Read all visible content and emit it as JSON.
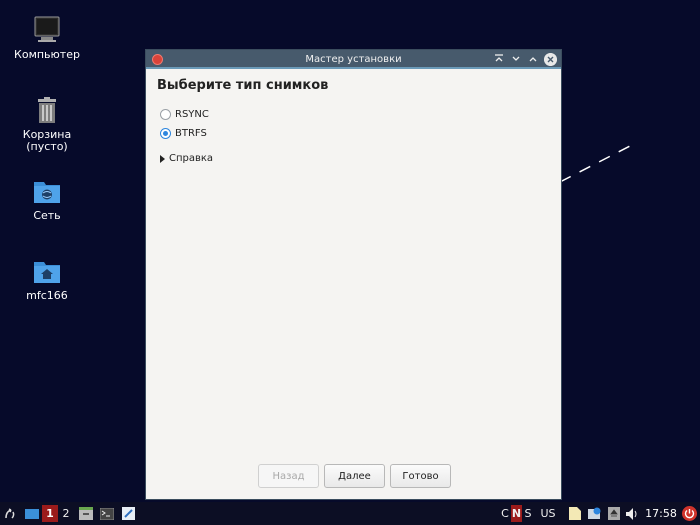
{
  "desktop": {
    "icons": [
      {
        "label": "Компьютер",
        "icon": "computer-icon"
      },
      {
        "label": "Корзина",
        "sublabel": "(пусто)",
        "icon": "trash-icon"
      },
      {
        "label": "Сеть",
        "icon": "network-folder-icon"
      },
      {
        "label": "mfc166",
        "icon": "home-folder-icon"
      }
    ]
  },
  "window": {
    "title": "Мастер установки",
    "heading": "Выберите тип снимков",
    "options": [
      {
        "label": "RSYNC",
        "checked": false
      },
      {
        "label": "BTRFS",
        "checked": true
      }
    ],
    "expander_label": "Справка",
    "buttons": {
      "back": "Назад",
      "next": "Далее",
      "done": "Готово"
    }
  },
  "taskbar": {
    "workspaces": [
      "1",
      "2"
    ],
    "active_workspace": "1",
    "keyboard_indicators": [
      "C",
      "N",
      "S"
    ],
    "layout": "US",
    "clock": "17:58"
  },
  "colors": {
    "desktop_bg": "#060a2a",
    "titlebar": "#475a6c",
    "accent": "#2e86de",
    "active_red": "#9b1b1b"
  }
}
